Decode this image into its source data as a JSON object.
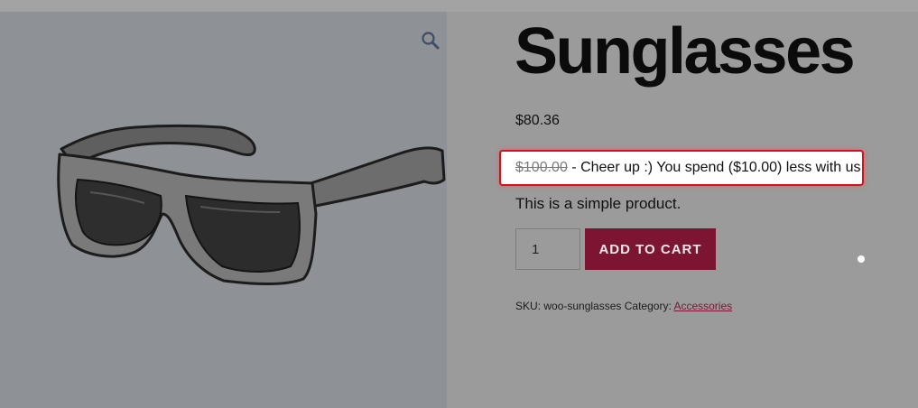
{
  "product": {
    "title": "Sunglasses",
    "price": "$80.36",
    "notice": {
      "old_price": "$100.00",
      "message": " - Cheer up :) You spend ($10.00) less with us"
    },
    "short_description": "This is a simple product.",
    "quantity": "1",
    "add_to_cart_label": "ADD TO CART",
    "meta": {
      "sku_label": "SKU:",
      "sku_value": "woo-sunglasses",
      "category_label": "Category:",
      "category_link": "Accessories"
    }
  },
  "gallery": {
    "zoom_icon": "magnifier-icon"
  },
  "colors": {
    "page_bg": "#9b9b9b",
    "gallery_bg": "#8e9195",
    "button_bg": "#7c1531",
    "notice_border": "#d4101a"
  }
}
